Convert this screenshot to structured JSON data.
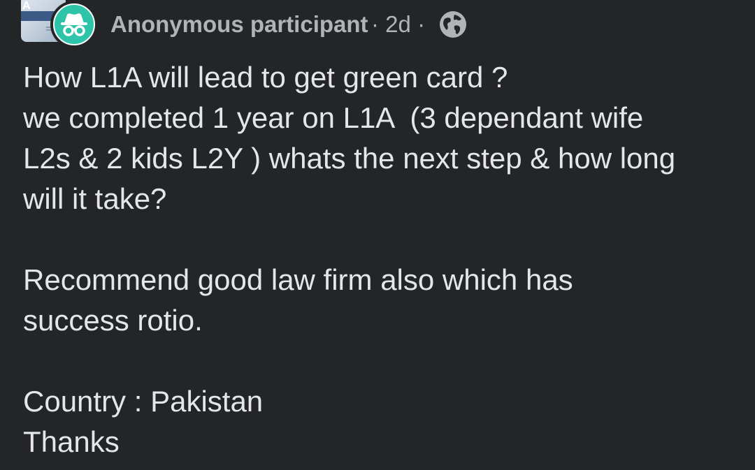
{
  "post": {
    "group_thumbnail_text": "A",
    "author": "Anonymous participant",
    "separator": "·",
    "time": "2d",
    "audience_icon": "globe-icon",
    "avatar_icon": "incognito-icon",
    "lines": [
      "How L1A will lead to get green card ?",
      "we completed 1 year on L1A  (3 dependant wife",
      "L2s & 2 kids L2Y ) whats the next step & how long",
      "will it take?",
      "",
      "Recommend good law firm also which has",
      "success rotio.",
      "",
      "Country : Pakistan",
      "Thanks"
    ]
  },
  "colors": {
    "background": "#242526",
    "text_primary": "#e4e6eb",
    "text_secondary": "#b0b3b8",
    "avatar_accent": "#2ec4a9"
  }
}
